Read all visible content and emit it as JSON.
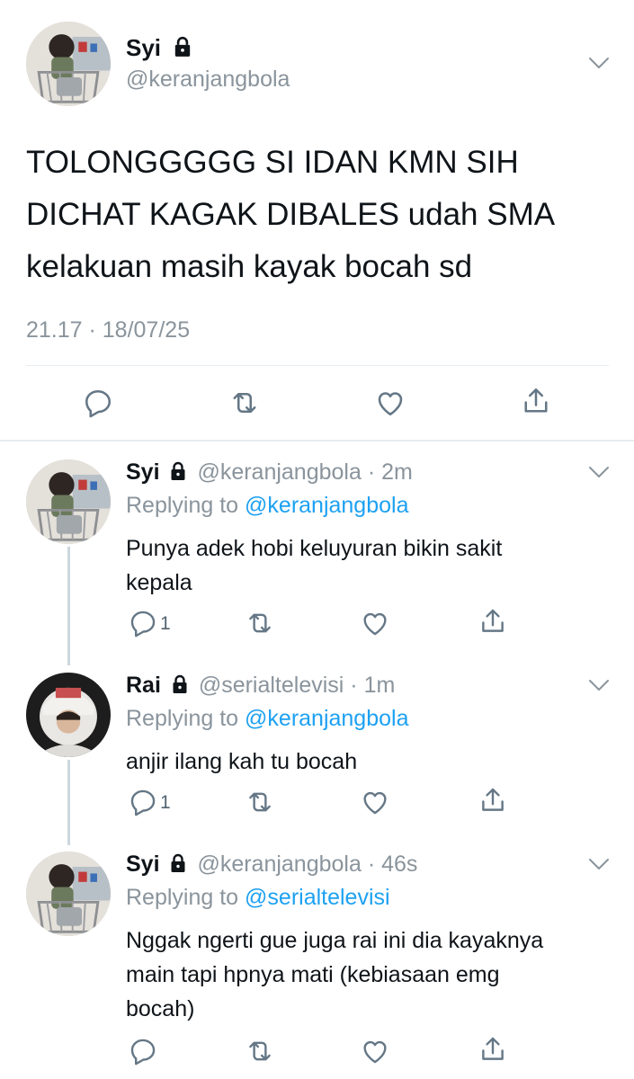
{
  "main_tweet": {
    "name": "Syi",
    "handle": "@keranjangbola",
    "text_lines": [
      "TOLONGGGGG SI IDAN KMN SIH",
      "DICHAT KAGAK DIBALES udah SMA",
      "kelakuan masih kayak bocah sd"
    ],
    "timestamp": "21.17 · 18/07/25",
    "actions": [
      "reply-icon",
      "retweet-icon",
      "like-icon",
      "share-icon"
    ]
  },
  "replies": [
    {
      "name": "Syi",
      "handle": "@keranjangbola",
      "time": "2m",
      "replying_label": "Replying to",
      "replying_to": "@keranjangbola",
      "text_lines": [
        "Punya adek hobi keluyuran bikin sakit",
        "kepala"
      ],
      "reply_count": "1"
    },
    {
      "name": "Rai",
      "handle": "@serialtelevisi",
      "time": "1m",
      "replying_label": "Replying to",
      "replying_to": "@keranjangbola",
      "text_lines": [
        "anjir ilang kah tu bocah"
      ],
      "reply_count": "1"
    },
    {
      "name": "Syi",
      "handle": "@keranjangbola",
      "time": "46s",
      "replying_label": "Replying to",
      "replying_to": "@serialtelevisi",
      "text_lines": [
        "Nggak ngerti gue juga rai ini dia kayaknya",
        "main tapi hpnya mati (kebiasaan emg",
        "bocah)"
      ],
      "reply_count": ""
    }
  ],
  "colors": {
    "accent": "#1da1f2",
    "muted": "#8a949c",
    "text": "#0f1419",
    "divider": "#e6ecf0"
  }
}
